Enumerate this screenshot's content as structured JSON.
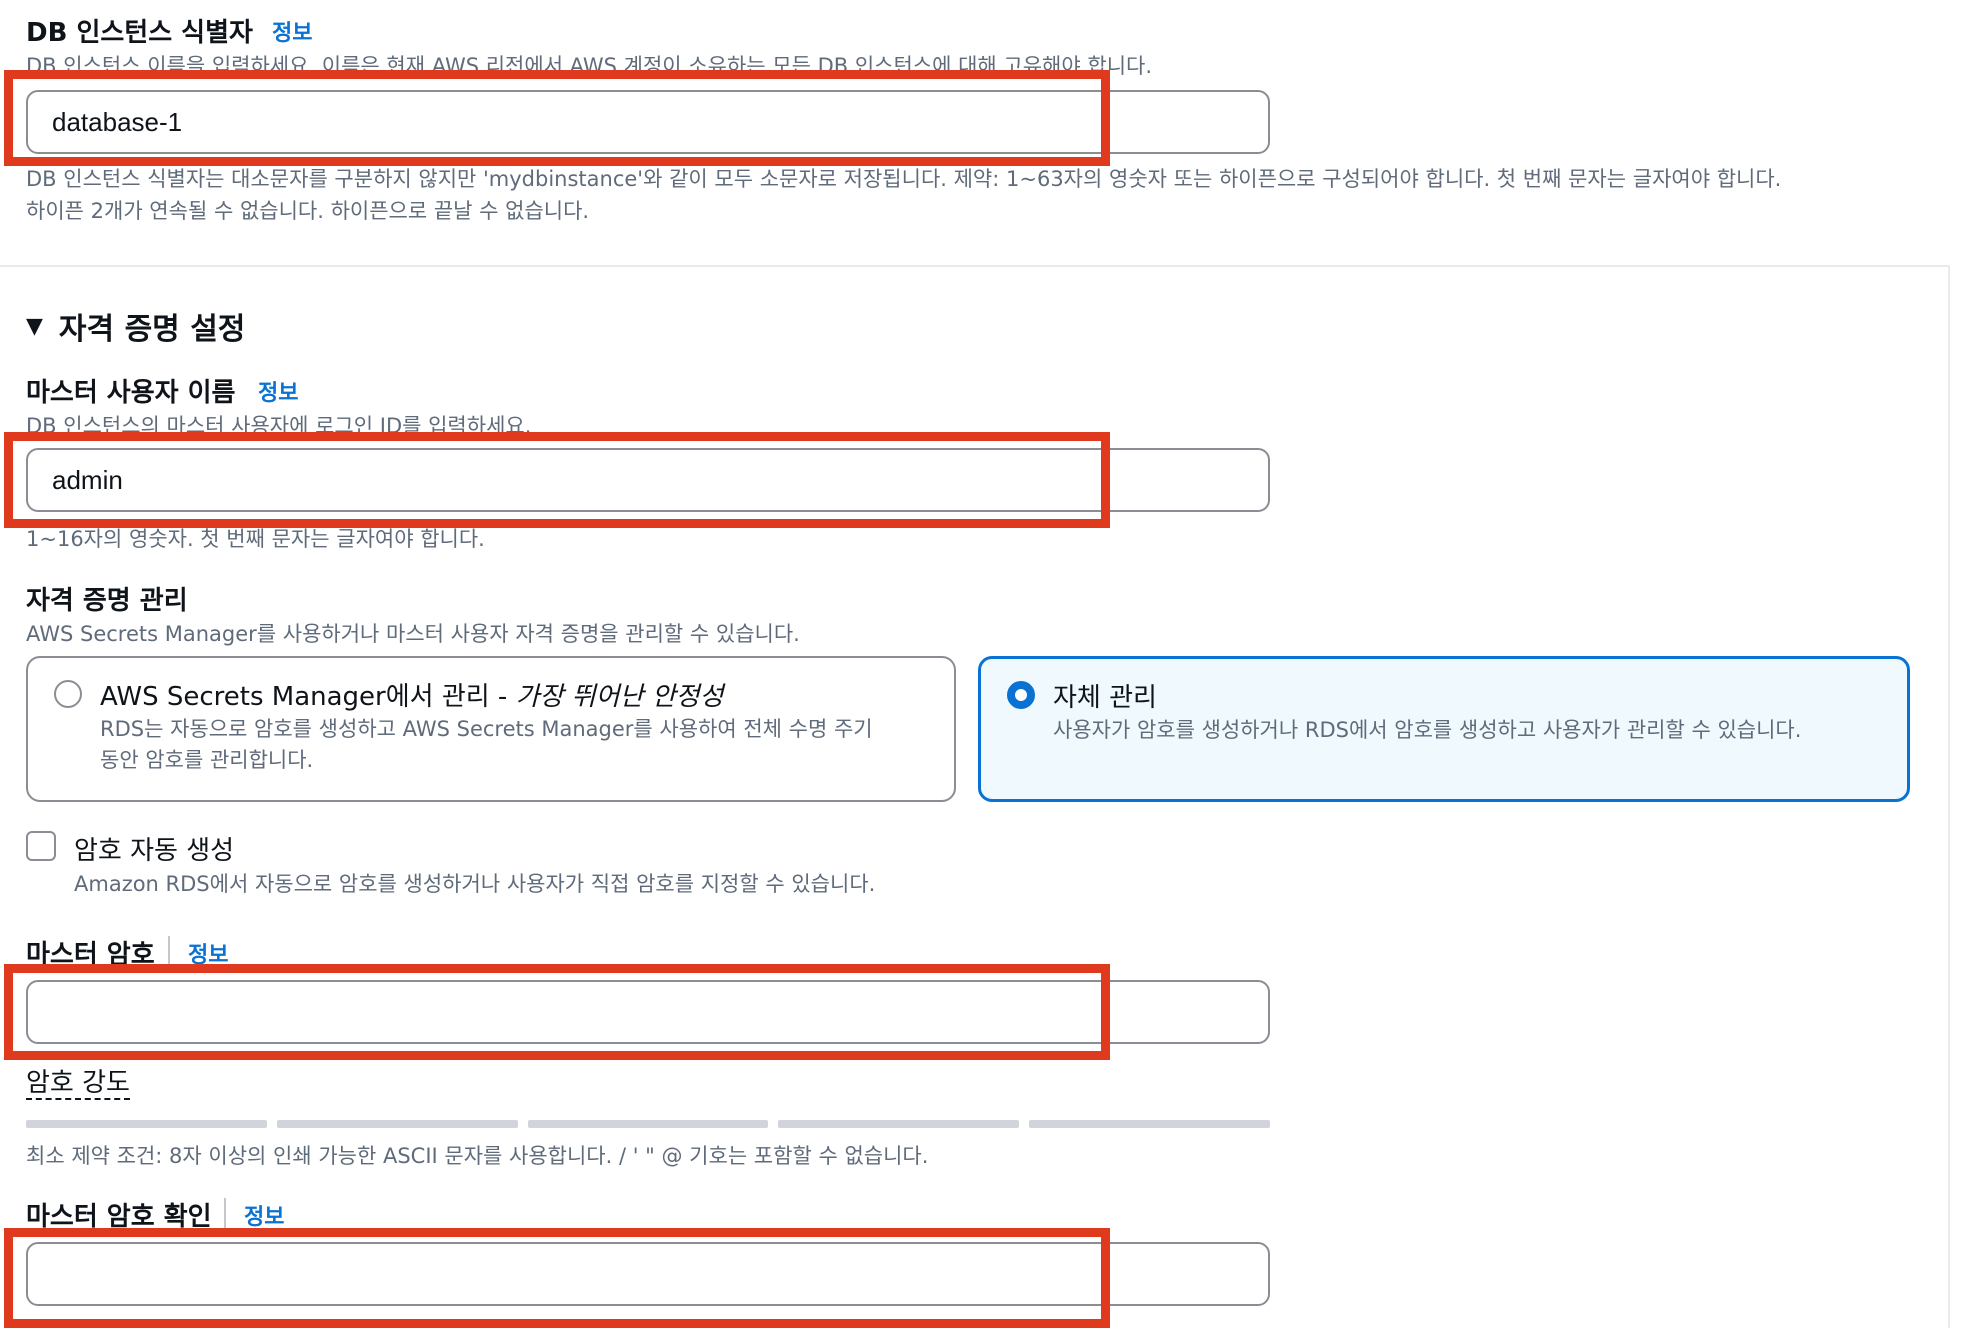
{
  "db_identifier": {
    "label": "DB 인스턴스 식별자",
    "info": "정보",
    "description": "DB 인스턴스 이름을 입력하세요. 이름은 현재 AWS 리전에서 AWS 계정이 소유하는 모든 DB 인스턴스에 대해 고유해야 합니다.",
    "value": "database-1",
    "help_line1": "DB 인스턴스 식별자는 대소문자를 구분하지 않지만 'mydbinstance'와 같이 모두 소문자로 저장됩니다. 제약: 1~63자의 영숫자 또는 하이픈으로 구성되어야 합니다. 첫 번째 문자는 글자여야 합니다.",
    "help_line2": "하이픈 2개가 연속될 수 없습니다. 하이픈으로 끝날 수 없습니다."
  },
  "credentials": {
    "section_title": "자격 증명 설정",
    "master_username": {
      "label": "마스터 사용자 이름",
      "info": "정보",
      "description": "DB 인스턴스의 마스터 사용자에 로그인 ID를 입력하세요.",
      "value": "admin",
      "help": "1~16자의 영숫자. 첫 번째 문자는 글자여야 합니다."
    },
    "management": {
      "label": "자격 증명 관리",
      "description": "AWS Secrets Manager를 사용하거나 마스터 사용자 자격 증명을 관리할 수 있습니다.",
      "options": [
        {
          "title": "AWS Secrets Manager에서 관리 - ",
          "title_emphasis": "가장 뛰어난 안정성",
          "desc_line1": "RDS는 자동으로 암호를 생성하고 AWS Secrets Manager를 사용하여 전체 수명 주기",
          "desc_line2": "동안 암호를 관리합니다.",
          "selected": false
        },
        {
          "title": "자체 관리",
          "desc_line1": "사용자가 암호를 생성하거나 RDS에서 암호를 생성하고 사용자가 관리할 수 있습니다.",
          "selected": true
        }
      ]
    },
    "auto_password": {
      "label": "암호 자동 생성",
      "description": "Amazon RDS에서 자동으로 암호를 생성하거나 사용자가 직접 암호를 지정할 수 있습니다.",
      "checked": false
    },
    "master_password": {
      "label": "마스터 암호",
      "info": "정보",
      "value": ""
    },
    "password_strength": {
      "label": "암호 강도",
      "constraint": "최소 제약 조건: 8자 이상의 인쇄 가능한 ASCII 문자를 사용합니다. / ' \" @ 기호는 포함할 수 없습니다."
    },
    "confirm_password": {
      "label": "마스터 암호 확인",
      "info": "정보",
      "value": ""
    }
  },
  "colors": {
    "accent": "#0972d3",
    "highlight_box": "#e03a1e"
  }
}
